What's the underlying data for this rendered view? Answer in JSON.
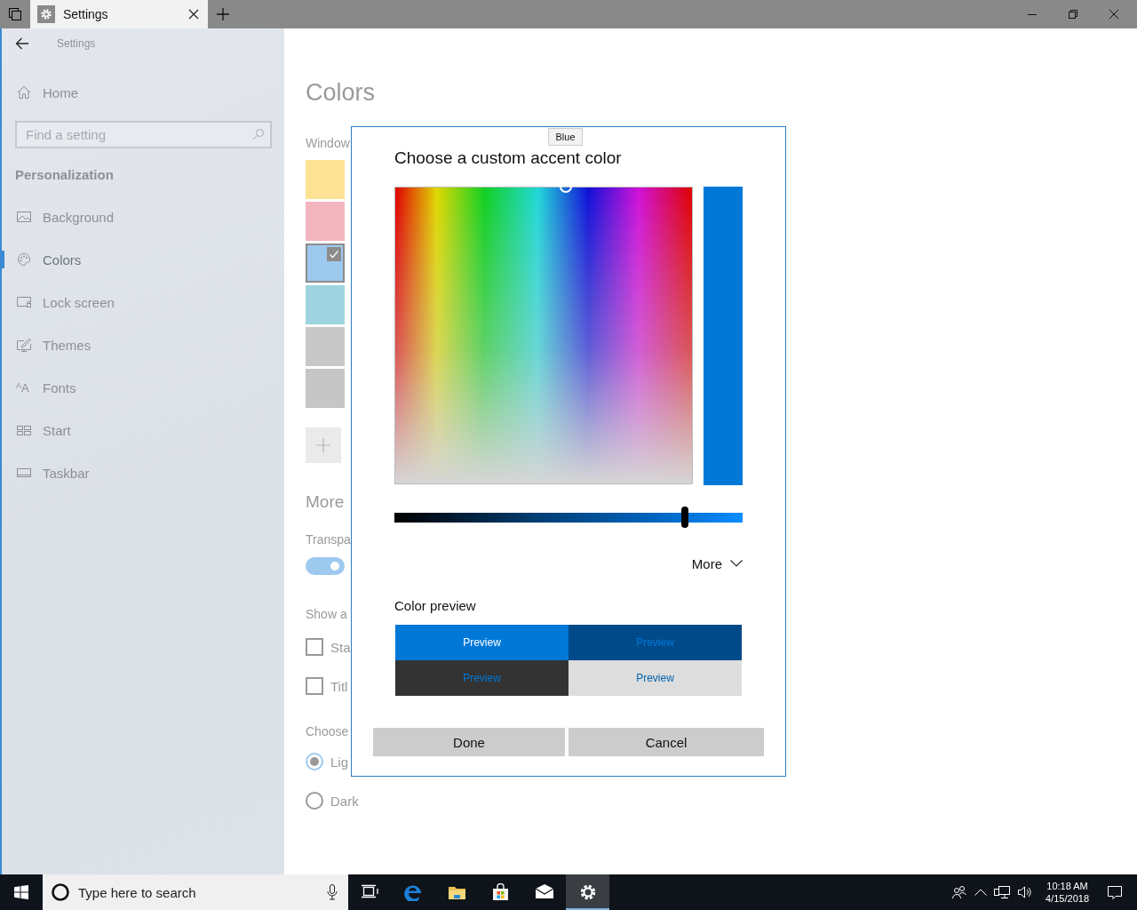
{
  "title_bar": {
    "tab_title": "Settings"
  },
  "sidebar": {
    "header": "Settings",
    "home": "Home",
    "search": {
      "placeholder": "Find a setting"
    },
    "section": "Personalization",
    "items": [
      {
        "label": "Background",
        "kind": "background",
        "selected": false
      },
      {
        "label": "Colors",
        "kind": "colors",
        "selected": true
      },
      {
        "label": "Lock screen",
        "kind": "lock",
        "selected": false
      },
      {
        "label": "Themes",
        "kind": "themes",
        "selected": false
      },
      {
        "label": "Fonts",
        "kind": "fonts",
        "icon_text": "$^{A}$A",
        "selected": false
      },
      {
        "label": "Start",
        "kind": "start",
        "selected": false
      },
      {
        "label": "Taskbar",
        "kind": "taskbar",
        "selected": false
      }
    ]
  },
  "page": {
    "title": "Colors",
    "accent_label": "Window",
    "swatches": [
      {
        "color": "#fde294",
        "selected": false
      },
      {
        "color": "#f4b6be",
        "selected": false
      },
      {
        "color": "#9ec9ef",
        "selected": true
      },
      {
        "color": "#9dd4e0",
        "selected": false
      },
      {
        "color": "#c8c8c8",
        "selected": false
      },
      {
        "color": "#c6c6c6",
        "selected": false
      }
    ],
    "more_heading": "More",
    "transparency_label": "Transpa",
    "transparency_toggle": {
      "on": true
    },
    "show_label": "Show a",
    "checkboxes": [
      {
        "label": "Sta",
        "checked": false
      },
      {
        "label": "Titl",
        "checked": false
      }
    ],
    "mode_label": "Choose",
    "modes": [
      {
        "label": "Lig",
        "selected": true
      },
      {
        "label": "Dark",
        "selected": false
      }
    ]
  },
  "dialog": {
    "title": "Choose a custom accent color",
    "tooltip": "Blue",
    "brightness": {
      "level": 0.834
    },
    "more": "More",
    "preview_label": "Color preview",
    "previews": [
      {
        "label": "Preview",
        "kind": "accent"
      },
      {
        "label": "Preview",
        "kind": "dark-accent"
      },
      {
        "label": "Preview",
        "kind": "dark"
      },
      {
        "label": "Preview",
        "kind": "light"
      }
    ],
    "buttons": [
      {
        "label": "Done"
      },
      {
        "label": "Cancel"
      }
    ]
  },
  "taskbar": {
    "search_placeholder": "Type here to search",
    "apps": [
      {
        "kind": "task-view",
        "active": false
      },
      {
        "kind": "browser",
        "active": false
      },
      {
        "kind": "folder",
        "active": false
      },
      {
        "kind": "store",
        "active": false
      },
      {
        "kind": "mail",
        "active": false
      },
      {
        "kind": "settings",
        "active": true
      }
    ],
    "time": "10:18 AM",
    "date": "4/15/2018"
  }
}
